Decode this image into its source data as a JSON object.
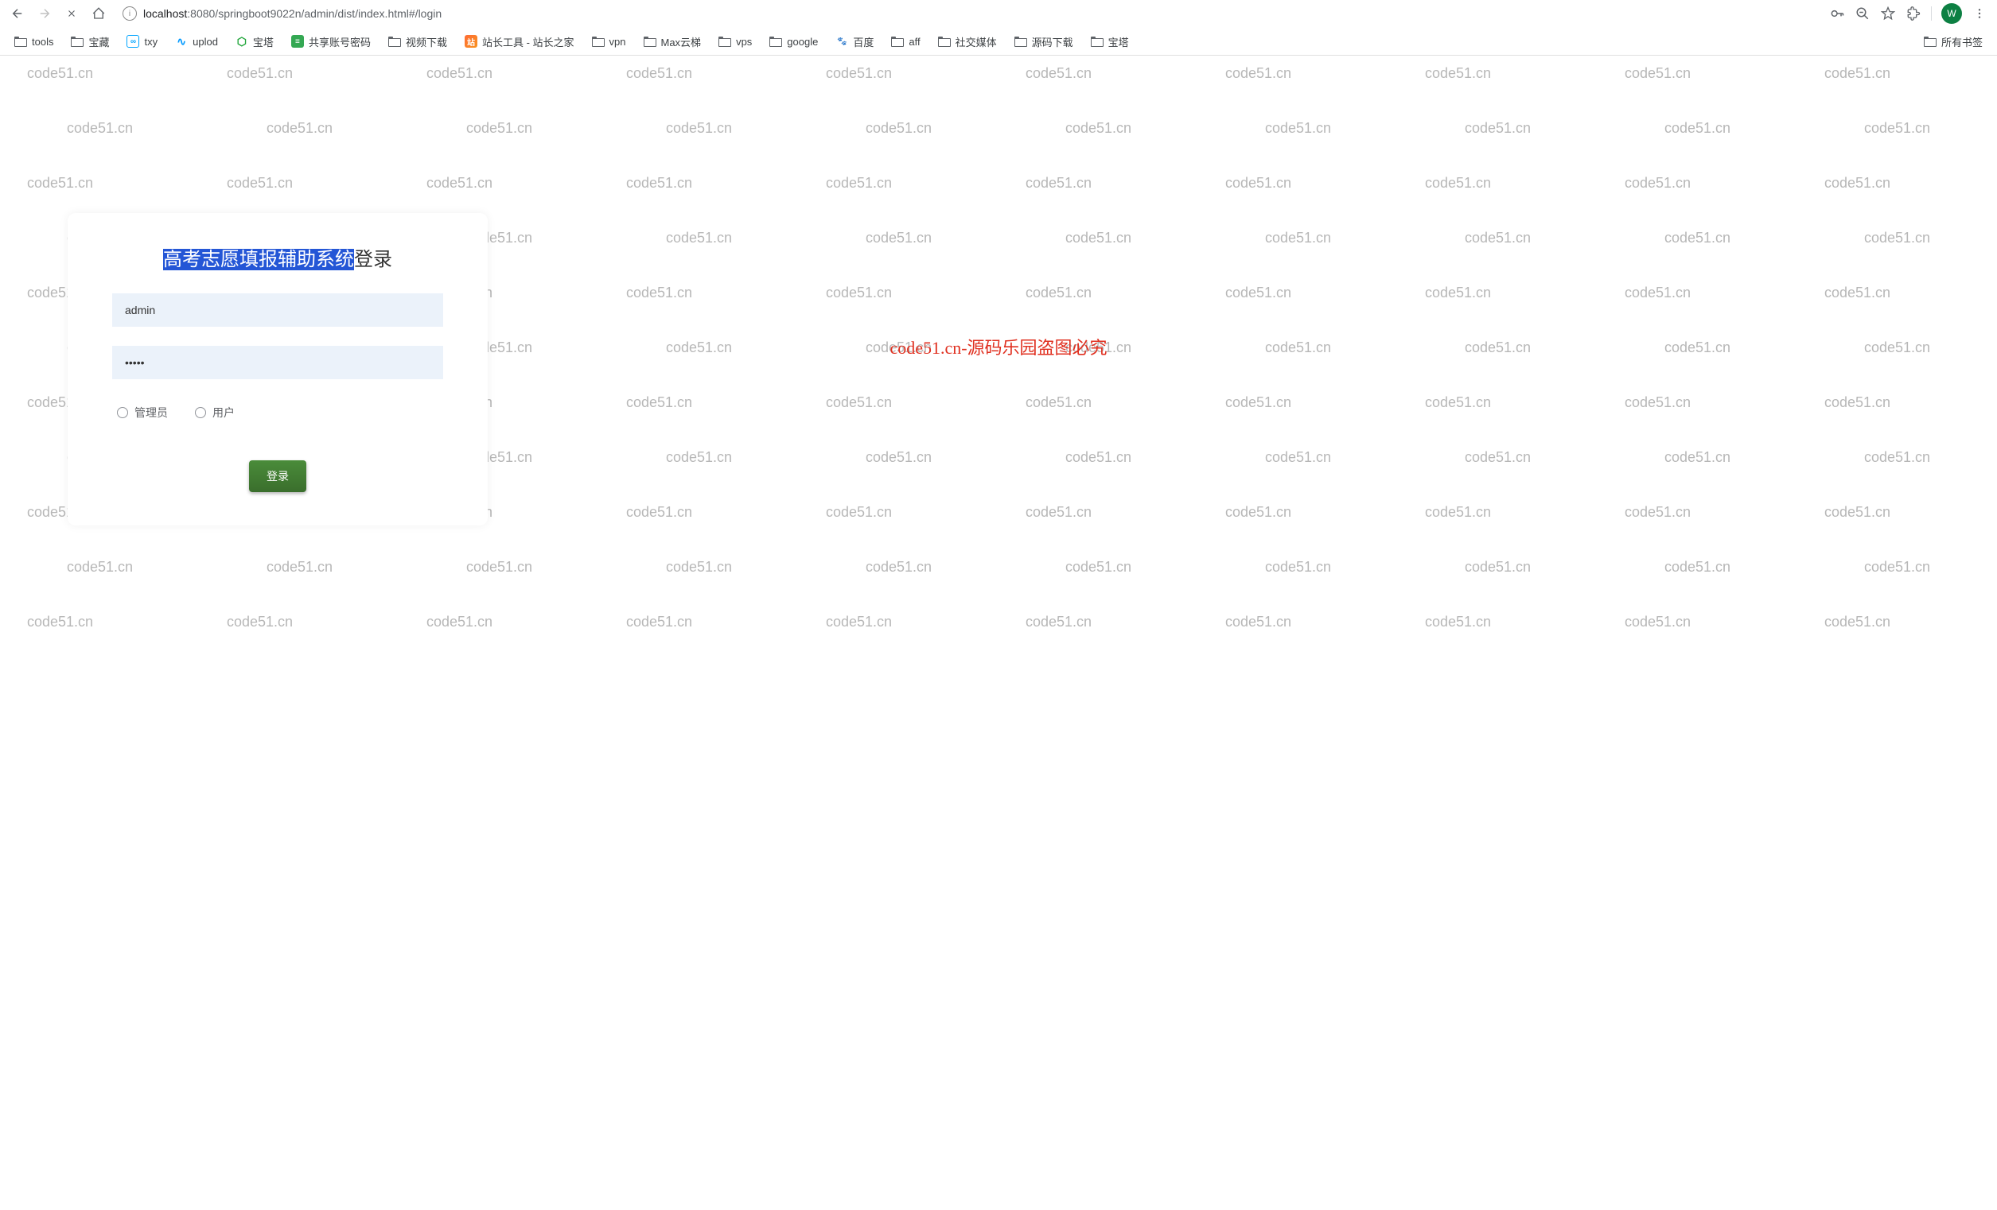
{
  "browser": {
    "url_host": "localhost",
    "url_path": ":8080/springboot9022n/admin/dist/index.html#/login",
    "avatar_letter": "W"
  },
  "bookmarks": [
    {
      "type": "folder",
      "label": "tools"
    },
    {
      "type": "folder",
      "label": "宝藏"
    },
    {
      "type": "favicon",
      "cls": "txy",
      "icon": "∞",
      "label": "txy"
    },
    {
      "type": "favicon",
      "cls": "uplod",
      "icon": "∿",
      "label": "uplod"
    },
    {
      "type": "favicon",
      "cls": "baota",
      "icon": "⬡",
      "label": "宝塔"
    },
    {
      "type": "favicon",
      "cls": "share",
      "icon": "≡",
      "label": "共享账号密码"
    },
    {
      "type": "folder",
      "label": "视频下载"
    },
    {
      "type": "favicon",
      "cls": "zhanzhang",
      "icon": "站",
      "label": "站长工具 - 站长之家"
    },
    {
      "type": "folder",
      "label": "vpn"
    },
    {
      "type": "folder",
      "label": "Max云梯"
    },
    {
      "type": "folder",
      "label": "vps"
    },
    {
      "type": "folder",
      "label": "google"
    },
    {
      "type": "favicon",
      "cls": "baidu",
      "icon": "🐾",
      "label": "百度"
    },
    {
      "type": "folder",
      "label": "aff"
    },
    {
      "type": "folder",
      "label": "社交媒体"
    },
    {
      "type": "folder",
      "label": "源码下载"
    },
    {
      "type": "folder",
      "label": "宝塔"
    }
  ],
  "bookmarks_tail": {
    "label": "所有书签"
  },
  "watermark": {
    "text": "code51.cn",
    "warning": "code51.cn-源码乐园盗图必究"
  },
  "login": {
    "title_highlight": "高考志愿填报辅助系统",
    "title_rest": "登录",
    "username_value": "admin",
    "password_value": "•••••",
    "role_admin": "管理员",
    "role_user": "用户",
    "submit_label": "登录"
  }
}
